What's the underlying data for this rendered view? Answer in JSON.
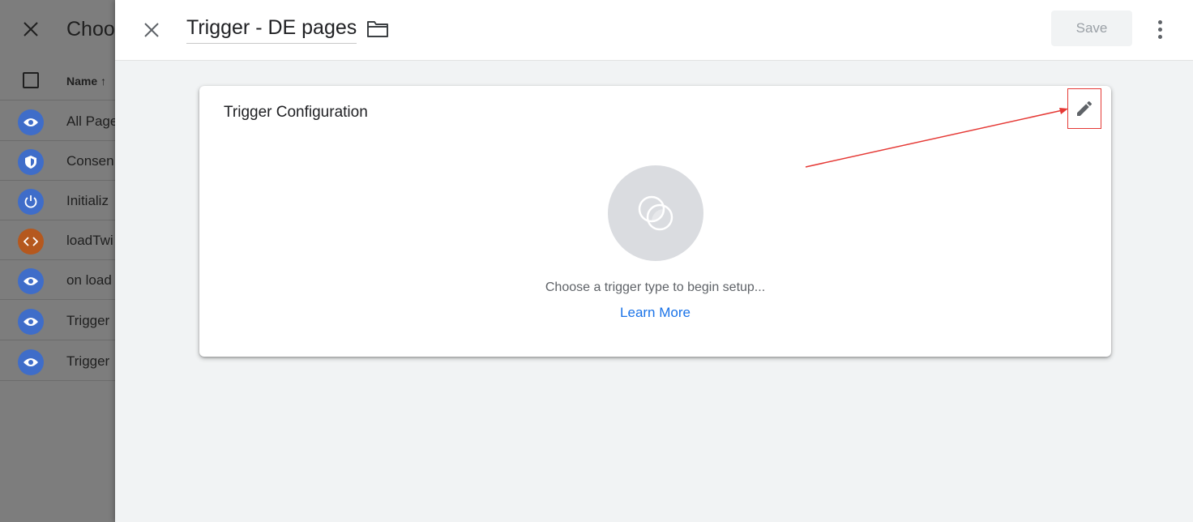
{
  "background_panel": {
    "title": "Choo",
    "column_header": "Name ↑",
    "rows": [
      {
        "label": "All Page",
        "icon": "eye-icon",
        "color": "#3f6dc9"
      },
      {
        "label": "Consen",
        "icon": "shield-icon",
        "color": "#3f6dc9"
      },
      {
        "label": "Initializ",
        "icon": "power-icon",
        "color": "#3f6dc9"
      },
      {
        "label": "loadTwi",
        "icon": "code-icon",
        "color": "#b5581e"
      },
      {
        "label": "on load",
        "icon": "eye-icon",
        "color": "#3f6dc9"
      },
      {
        "label": "Trigger",
        "icon": "eye-icon",
        "color": "#3f6dc9"
      },
      {
        "label": "Trigger",
        "icon": "eye-icon",
        "color": "#3f6dc9"
      }
    ]
  },
  "header": {
    "title": "Trigger - DE pages",
    "save_label": "Save"
  },
  "card": {
    "title": "Trigger Configuration",
    "prompt": "Choose a trigger type to begin setup...",
    "learn_more": "Learn More"
  },
  "colors": {
    "accent_link": "#1a73e8",
    "annotation": "#e53935"
  }
}
